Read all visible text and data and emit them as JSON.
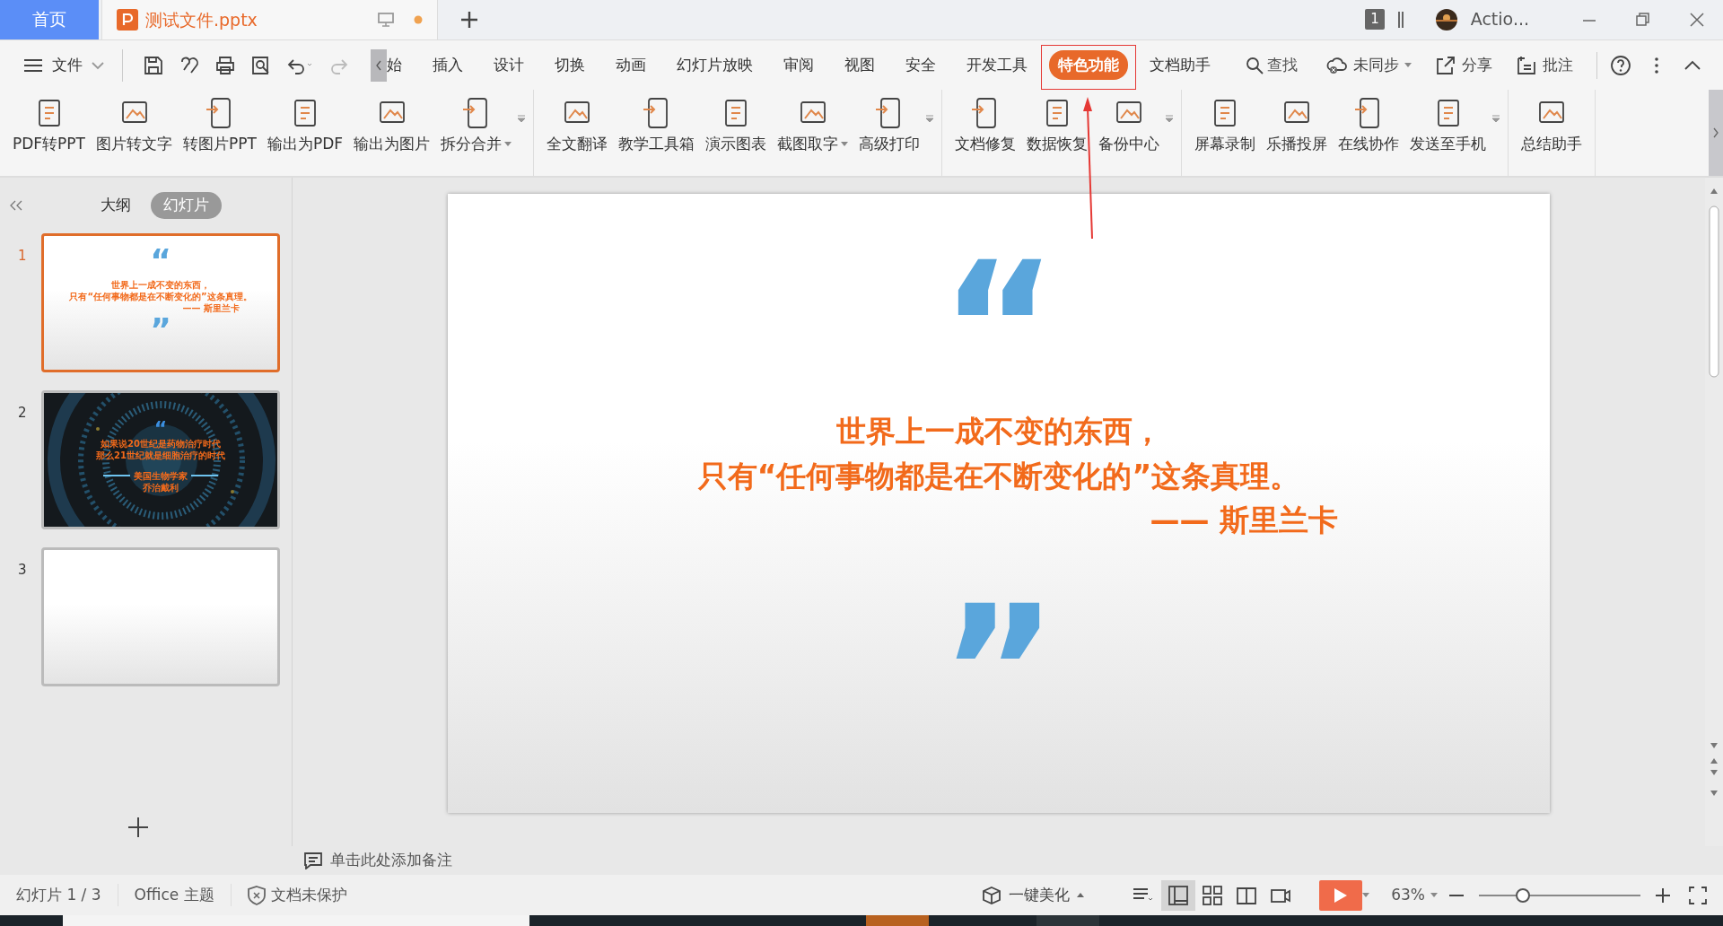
{
  "tabs": [
    {
      "label": "首页",
      "kind": "home",
      "selected": false
    },
    {
      "label": "测试文件.pptx",
      "kind": "document",
      "selected": true
    }
  ],
  "title_bar": {
    "count": "1",
    "user": "Actio..."
  },
  "menu": {
    "file": "文件",
    "items": [
      {
        "label": "始",
        "selected": false
      },
      {
        "label": "插入",
        "selected": false
      },
      {
        "label": "设计",
        "selected": false
      },
      {
        "label": "切换",
        "selected": false
      },
      {
        "label": "动画",
        "selected": false
      },
      {
        "label": "幻灯片放映",
        "selected": false
      },
      {
        "label": "审阅",
        "selected": false
      },
      {
        "label": "视图",
        "selected": false
      },
      {
        "label": "安全",
        "selected": false
      },
      {
        "label": "开发工具",
        "selected": false
      },
      {
        "label": "特色功能",
        "selected": true
      },
      {
        "label": "文档助手",
        "selected": false
      }
    ],
    "search": "查找",
    "actions": [
      {
        "label": "未同步",
        "kind": "cloud"
      },
      {
        "label": "分享",
        "kind": "share"
      },
      {
        "label": "批注",
        "kind": "comment"
      }
    ]
  },
  "tool_groups": [
    {
      "items": [
        {
          "label": "PDF转PPT",
          "dropdown": false
        },
        {
          "label": "图片转文字",
          "dropdown": false
        },
        {
          "label": "转图片PPT",
          "dropdown": false
        },
        {
          "label": "输出为PDF",
          "dropdown": false
        },
        {
          "label": "输出为图片",
          "dropdown": false
        },
        {
          "label": "拆分合并",
          "dropdown": true
        }
      ]
    },
    {
      "items": [
        {
          "label": "全文翻译",
          "dropdown": false
        },
        {
          "label": "教学工具箱",
          "dropdown": false
        },
        {
          "label": "演示图表",
          "dropdown": false
        },
        {
          "label": "截图取字",
          "dropdown": true
        },
        {
          "label": "高级打印",
          "dropdown": false
        }
      ]
    },
    {
      "items": [
        {
          "label": "文档修复",
          "dropdown": false
        },
        {
          "label": "数据恢复",
          "dropdown": false
        },
        {
          "label": "备份中心",
          "dropdown": false
        }
      ]
    },
    {
      "items": [
        {
          "label": "屏幕录制",
          "dropdown": false
        },
        {
          "label": "乐播投屏",
          "dropdown": false
        },
        {
          "label": "在线协作",
          "dropdown": false
        },
        {
          "label": "发送至手机",
          "dropdown": false
        }
      ]
    },
    {
      "items": [
        {
          "label": "总结助手",
          "dropdown": false
        }
      ]
    }
  ],
  "panel_tabs": [
    {
      "label": "大纲",
      "selected": false
    },
    {
      "label": "幻灯片",
      "selected": true
    }
  ],
  "slides": [
    {
      "number": "1",
      "selected": true,
      "kind": "quote",
      "open_quote": "“",
      "close_quote": "”",
      "lines": [
        "世界上一成不变的东西，",
        "只有“任何事物都是在不断变化的”这条真理。"
      ],
      "author": "—— 斯里兰卡"
    },
    {
      "number": "2",
      "selected": false,
      "kind": "picture-quote",
      "open_quote": "“",
      "lines": [
        "如果说20世纪是药物治疗时代",
        "那么21世纪就是细胞治疗的时代"
      ],
      "byline": [
        "美国生物学家",
        "乔治戴利"
      ]
    },
    {
      "number": "3",
      "selected": false,
      "kind": "blank"
    }
  ],
  "main_slide": {
    "open_quote": "“",
    "close_quote": "”",
    "lines": [
      "世界上一成不变的东西，",
      "只有“任何事物都是在不断变化的”这条真理。"
    ],
    "author": "—— 斯里兰卡"
  },
  "notes": "单击此处添加备注",
  "status": {
    "items": [
      "幻灯片 1 / 3",
      "Office 主题",
      "文档未保护"
    ],
    "beautify": "一键美化",
    "zoom": "63%",
    "level": 0.27
  }
}
